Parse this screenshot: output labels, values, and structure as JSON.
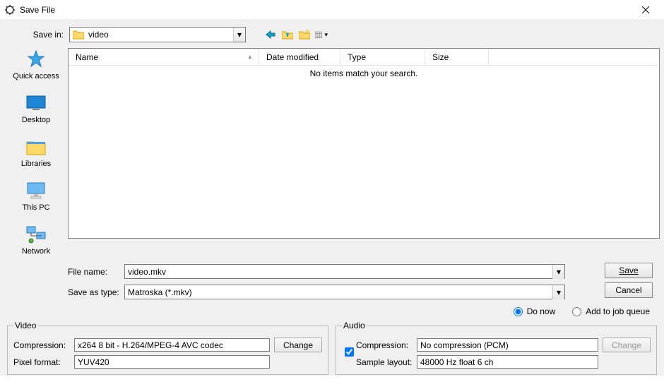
{
  "window": {
    "title": "Save File"
  },
  "savein": {
    "label": "Save in:",
    "value": "video"
  },
  "places": {
    "quick_access": "Quick access",
    "desktop": "Desktop",
    "libraries": "Libraries",
    "this_pc": "This PC",
    "network": "Network"
  },
  "columns": {
    "name": "Name",
    "date": "Date modified",
    "type": "Type",
    "size": "Size"
  },
  "empty_message": "No items match your search.",
  "filename": {
    "label": "File name:",
    "value": "video.mkv"
  },
  "saveastype": {
    "label": "Save as type:",
    "value": "Matroska (*.mkv)"
  },
  "buttons": {
    "save": "Save",
    "cancel": "Cancel",
    "change": "Change"
  },
  "radios": {
    "do_now": "Do now",
    "add_queue": "Add to job queue"
  },
  "video_group": {
    "legend": "Video",
    "compression_label": "Compression:",
    "compression_value": "x264 8 bit - H.264/MPEG-4 AVC codec",
    "pixel_format_label": "Pixel format:",
    "pixel_format_value": "YUV420"
  },
  "audio_group": {
    "legend": "Audio",
    "compression_label": "Compression:",
    "compression_value": "No compression (PCM)",
    "sample_layout_label": "Sample layout:",
    "sample_layout_value": "48000 Hz float 6 ch"
  }
}
